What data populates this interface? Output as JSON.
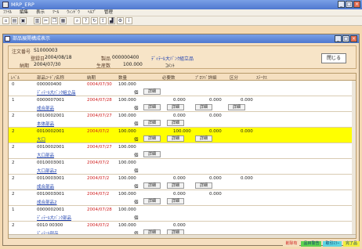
{
  "window": {
    "title": "MRP_ERP"
  },
  "menu": [
    "ﾌｧｲﾙ",
    "編集",
    "表示",
    "ﾂｰﾙ",
    "ｳｨﾝﾄﾞｳ",
    "ﾍﾙﾌﾟ",
    "管理"
  ],
  "toolbar_icons": [
    "new-icon",
    "open-icon",
    "save-icon",
    "print-icon",
    "cut-icon",
    "copy-icon",
    "paste-icon",
    "find-icon",
    "help-icon",
    "refresh-icon",
    "export-icon",
    "chart-icon",
    "settings-icon",
    "info-icon"
  ],
  "inner": {
    "title": "部品展開構成表示"
  },
  "info": {
    "order_label": "注文番号",
    "order_no": "S1000003",
    "reg_label": "登録日",
    "reg_date": "2004/08/18",
    "item_label": "製品",
    "item_code": "000000400",
    "item_name": "ﾃﾞｨﾃｰﾙ大ﾊﾞﾝｸ組立品",
    "due_label": "納期",
    "due_date": "2004/07/30",
    "qty_label": "生産数",
    "qty": "100.000",
    "note": "ｺﾒﾝﾄ"
  },
  "close_label": "閉じる",
  "table": {
    "headers": [
      "ﾚﾍﾞﾙ",
      "部品ｺｰﾄﾞ/名称",
      "納期",
      "数量",
      "必要数",
      "ﾌﾟﾛﾂﾊﾞ詳細",
      "区分",
      "ｽﾃｰﾀｽ"
    ],
    "rows": [
      {
        "level": "0",
        "code": "000000400",
        "name": "ﾃﾞｨﾃｰﾙ大ﾊﾞﾝｸ組立品",
        "date": "0004/07/30",
        "qty": "100.000",
        "unit": "個",
        "btn1": "詳細",
        "c1": "",
        "c2": "",
        "c3": ""
      },
      {
        "level": "1",
        "code": "0000007001",
        "name": "成合部品",
        "date": "2004/07/28",
        "qty": "100.000",
        "unit": "個",
        "btn1": "詳細",
        "c1": "0.000",
        "btn2": "詳細",
        "c2": "0.000",
        "btn3": "詳細",
        "c3": "0.000",
        "btn4": "詳細"
      },
      {
        "level": "2",
        "code": "0010002001",
        "name": "本体部品",
        "date": "2004/07/27",
        "qty": "100.000",
        "unit": "個",
        "btn1": "詳細",
        "c1": "0.000",
        "btn2": "詳細",
        "c2": "0.000",
        "btn3": "",
        "c3": "",
        "btn4": ""
      },
      {
        "level": "2",
        "code": "0010002001",
        "name": "大口",
        "date": "2004/07/2",
        "qty": "100.000",
        "unit": "個",
        "btn1": "詳細",
        "c1": "100.000",
        "btn2": "詳細",
        "c2": "0.000",
        "btn3": "詳細",
        "c3": "0.000",
        "btn4": ""
      },
      {
        "level": "2",
        "code": "0010002001",
        "name": "大口部品",
        "date": "2004/07/27",
        "qty": "100.000",
        "unit": "個",
        "btn1": "詳細",
        "c1": "",
        "btn2": "",
        "c2": "",
        "btn3": "",
        "c3": "",
        "btn4": ""
      },
      {
        "level": "2",
        "code": "0010003001",
        "name": "大口部品2",
        "date": "2004/07/2",
        "qty": "100.000",
        "unit": "個",
        "btn1": "",
        "c1": "",
        "btn2": "",
        "c2": "",
        "btn3": "",
        "c3": "",
        "btn4": ""
      },
      {
        "level": "2",
        "code": "0010003001",
        "name": "成合部品",
        "date": "2004/07/2",
        "qty": "100.000",
        "unit": "個",
        "btn1": "詳細",
        "c1": "0.000",
        "btn2": "詳細",
        "c2": "0.000",
        "btn3": "詳細",
        "c3": "0.000",
        "btn4": ""
      },
      {
        "level": "2",
        "code": "0010003001",
        "name": "成合部品2",
        "date": "2004/07/2",
        "qty": "100.000",
        "unit": "個",
        "btn1": "詳細",
        "c1": "0.000",
        "btn2": "詳細",
        "c2": "0.000",
        "btn3": "",
        "c3": "",
        "btn4": ""
      },
      {
        "level": "1",
        "code": "0000002001",
        "name": "ﾃﾞｨﾃｰﾙ大ﾊﾞﾝｸ部品",
        "date": "2004/07/28",
        "qty": "100.000",
        "unit": "個",
        "btn1": "",
        "c1": "",
        "btn2": "",
        "c2": "",
        "btn3": "",
        "c3": "",
        "btn4": ""
      },
      {
        "level": "2",
        "code": "0010 00300",
        "name": "ﾃﾞｨﾃｰﾙ部品",
        "date": "2004/07/2",
        "qty": "100.000",
        "unit": "個",
        "btn1": "詳細",
        "c1": "0.000",
        "btn2": "詳細",
        "c2": "",
        "btn3": "",
        "c3": "",
        "btn4": ""
      }
    ]
  },
  "status": [
    "削除有",
    "品目警告",
    "取引ｴﾗｰ",
    "完了品"
  ]
}
